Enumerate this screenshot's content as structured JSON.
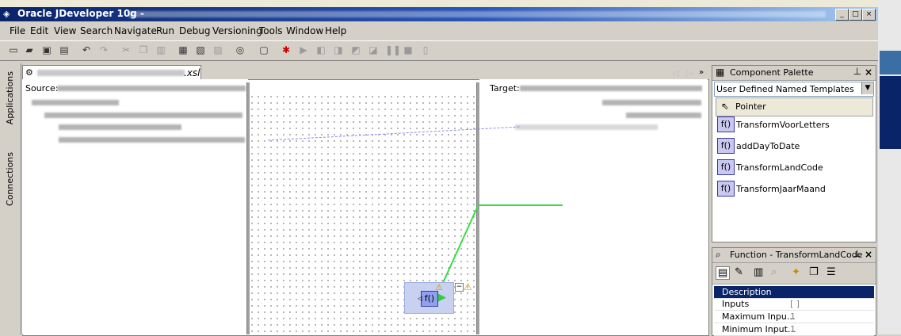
{
  "window": {
    "app_name": "Oracle JDeveloper 10g",
    "separator": "-",
    "btn_min": "_",
    "btn_max": "□",
    "btn_close": "×"
  },
  "menu": [
    "File",
    "Edit",
    "View",
    "Search",
    "Navigate",
    "Run",
    "Debug",
    "Versioning",
    "Tools",
    "Window",
    "Help"
  ],
  "toolbar": {
    "icons": [
      "new-icon",
      "open-icon",
      "save-icon",
      "save-all-icon",
      "undo-icon",
      "redo-icon",
      "cut-icon",
      "copy-icon",
      "paste-icon",
      "make-icon",
      "rebuild-icon",
      "rebuild-all-icon",
      "deploy-icon",
      "run-icon",
      "debug-icon",
      "resume-icon",
      "step-over-icon",
      "step-into-icon",
      "step-out-icon",
      "step-to-end-icon",
      "pause-icon",
      "stop-icon",
      "garbage-icon"
    ]
  },
  "side_tabs": {
    "applications": "Applications",
    "connections": "Connections"
  },
  "editor": {
    "tab_ext": ".xsl",
    "source_label": "Source:",
    "target_label": "Target:",
    "function_node": "f()"
  },
  "palette": {
    "title": "Component Palette",
    "dropdown": "User Defined Named Templates",
    "pointer": "Pointer",
    "items": [
      "TransformVoorLetters",
      "addDayToDate",
      "TransformLandCode",
      "TransformJaarMaand"
    ],
    "func_glyph": "f()"
  },
  "function_panel": {
    "title": "Function - TransformLandCode",
    "rows": [
      {
        "key": "Description",
        "value": ""
      },
      {
        "key": "Inputs",
        "value": "[ ]"
      },
      {
        "key": "Maximum Inpu...",
        "value": "1"
      },
      {
        "key": "Minimum Input...",
        "value": "1"
      }
    ]
  },
  "colors": {
    "title_start": "#0a246a",
    "selection": "#0a246a",
    "link_green": "#33dd44",
    "panel_bg": "#d4d0c8"
  }
}
